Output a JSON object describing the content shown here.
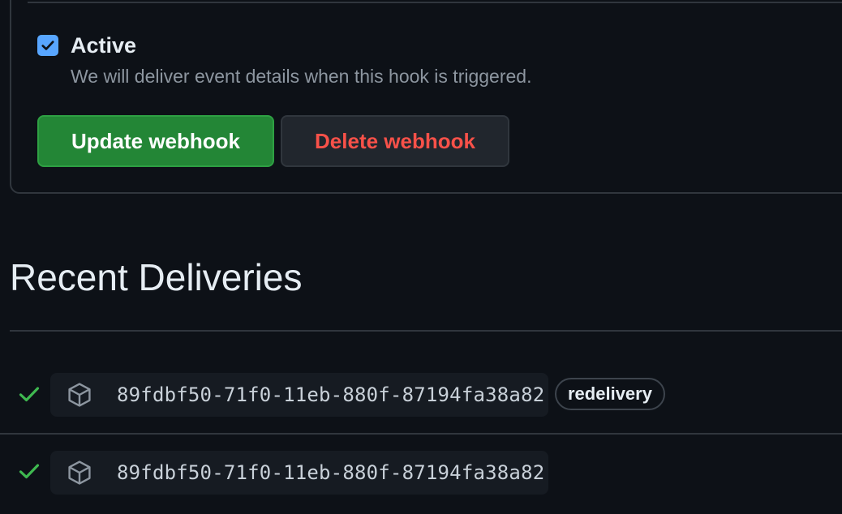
{
  "webhook_settings": {
    "active": {
      "checked": true,
      "label": "Active",
      "description": "We will deliver event details when this hook is triggered."
    },
    "update_button_label": "Update webhook",
    "delete_button_label": "Delete webhook"
  },
  "recent_deliveries": {
    "title": "Recent Deliveries",
    "items": [
      {
        "status": "success",
        "guid": "89fdbf50-71f0-11eb-880f-87194fa38a82",
        "badge": "redelivery"
      },
      {
        "status": "success",
        "guid": "89fdbf50-71f0-11eb-880f-87194fa38a82"
      }
    ]
  },
  "colors": {
    "background": "#0d1117",
    "border": "#30363d",
    "accent_blue": "#58a6ff",
    "success_green": "#3fb950",
    "button_green": "#238636",
    "danger_red": "#f85149"
  },
  "icons": {
    "checkbox": "checkmark-icon",
    "status": "check-icon",
    "delivery": "package-icon"
  }
}
